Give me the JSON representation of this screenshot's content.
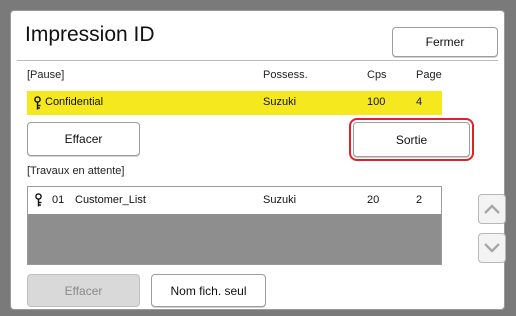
{
  "dialog": {
    "title": "Impression ID",
    "close_label": "Fermer"
  },
  "paused_section": {
    "label": "[Pause]",
    "columns": {
      "owner": "Possess.",
      "copies": "Cps",
      "page": "Page"
    },
    "job": {
      "icon": "key-icon",
      "name": "Confidential",
      "owner": "Suzuki",
      "copies": "100",
      "page": "4"
    },
    "delete_label": "Effacer",
    "output_label": "Sortie"
  },
  "waiting_section": {
    "label": "[Travaux en attente]",
    "jobs": [
      {
        "icon": "key-icon",
        "number": "01",
        "name": "Customer_List",
        "owner": "Suzuki",
        "copies": "20",
        "page": "2"
      }
    ],
    "delete_label": "Effacer",
    "filename_only_label": "Nom fich. seul"
  },
  "colors": {
    "highlight_row": "#f6e81f",
    "focus_ring": "#e0202a"
  }
}
